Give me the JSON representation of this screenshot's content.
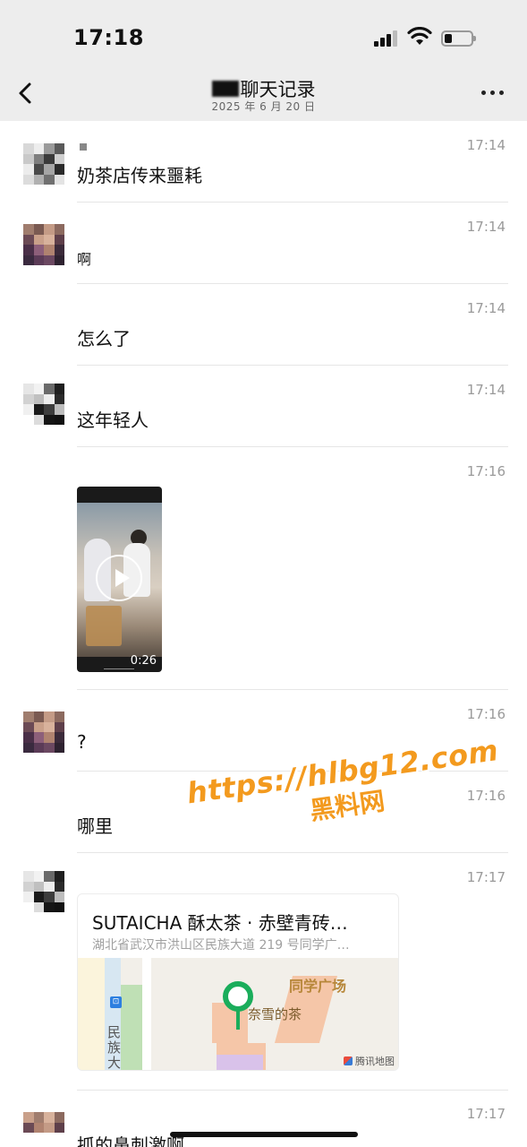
{
  "status_bar": {
    "time": "17:18"
  },
  "nav": {
    "title": "聊天记录",
    "subtitle": "2025 年 6 月 20 日"
  },
  "messages": [
    {
      "time": "17:14",
      "text": "奶茶店传来噩耗"
    },
    {
      "time": "17:14",
      "text": "啊"
    },
    {
      "time": "17:14",
      "text": "怎么了"
    },
    {
      "time": "17:14",
      "text": "这年轻人"
    },
    {
      "time": "17:16",
      "video_duration": "0:26"
    },
    {
      "time": "17:16",
      "text": "?"
    },
    {
      "time": "17:16",
      "text": "哪里"
    },
    {
      "time": "17:17",
      "location": {
        "name": "SUTAICHA 酥太茶 · 赤壁青砖…",
        "address": "湖北省武汉市洪山区民族大道 219 号同学广…",
        "map_poi": "同学广场",
        "map_shop": "奈雪的茶",
        "map_street": "民族大",
        "map_provider": "腾讯地图"
      }
    },
    {
      "time": "17:17",
      "text": "抓的鼻刺激啊"
    }
  ],
  "watermark": {
    "line1": "https://hlbg12.com",
    "line2": "黑料网"
  }
}
